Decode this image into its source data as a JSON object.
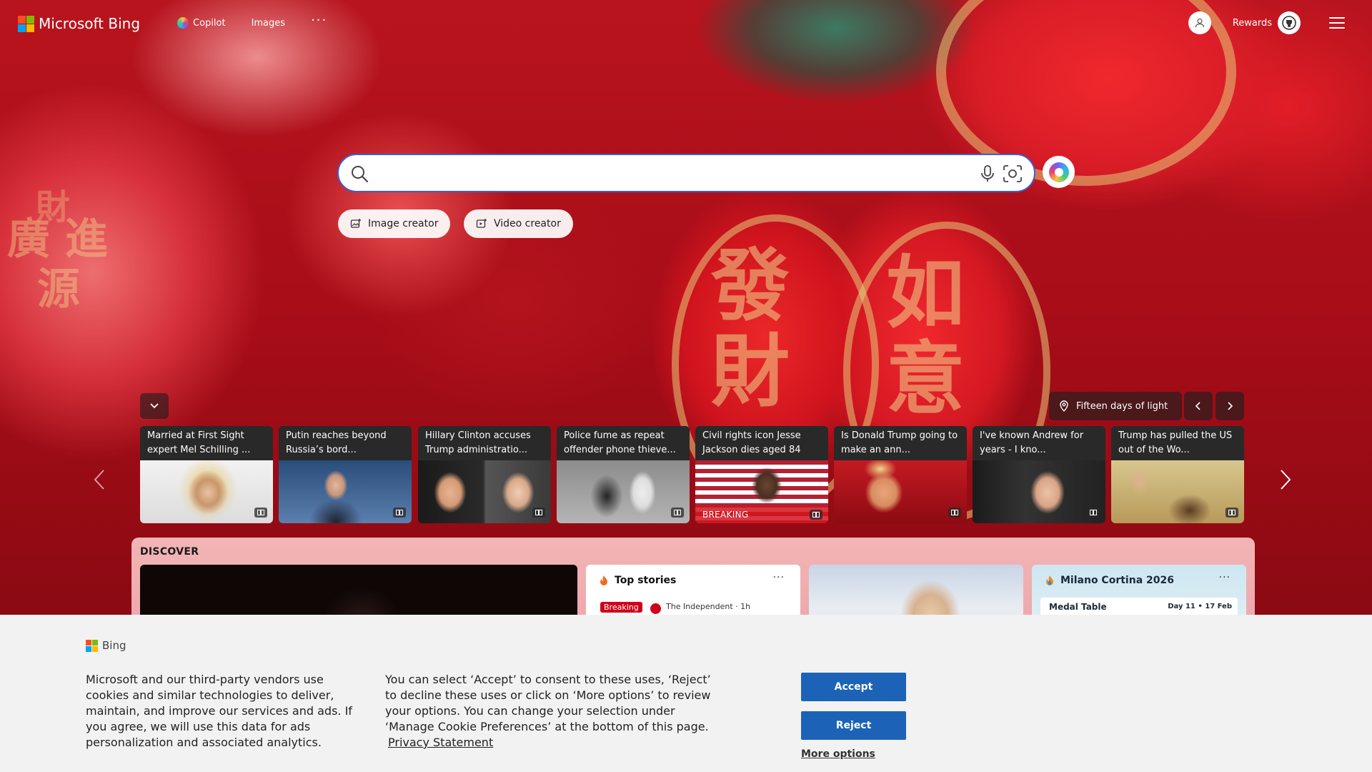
{
  "header": {
    "logo_text": "Microsoft Bing",
    "nav": [
      {
        "label": "Copilot"
      },
      {
        "label": "Images"
      }
    ],
    "more_label": "···",
    "rewards_label": "Rewards"
  },
  "search": {
    "placeholder": "",
    "value": ""
  },
  "creators": {
    "image_creator": "Image creator",
    "video_creator": "Video creator"
  },
  "location": {
    "label": "Fifteen days of light"
  },
  "news_cards": [
    {
      "title": "Married at First Sight expert Mel Schilling ...",
      "badge": ""
    },
    {
      "title": "Putin reaches beyond Russia’s bord...",
      "badge": ""
    },
    {
      "title": "Hillary Clinton accuses Trump administratio...",
      "badge": ""
    },
    {
      "title": "Police fume as repeat offender phone thieve...",
      "badge": ""
    },
    {
      "title": "Civil rights icon Jesse Jackson dies aged 84",
      "badge": "BREAKING"
    },
    {
      "title": "Is Donald Trump going to make an ann...",
      "badge": ""
    },
    {
      "title": "I've known Andrew for years - I kno...",
      "badge": ""
    },
    {
      "title": "Trump has pulled the US out of the Wo...",
      "badge": ""
    }
  ],
  "discover": {
    "title": "DISCOVER",
    "top_stories": {
      "title": "Top stories",
      "more": "···",
      "badge": "Breaking",
      "source": "The Independent · 1h"
    },
    "milano": {
      "title": "Milano Cortina 2026",
      "more": "···",
      "medal_table": "Medal Table",
      "day": "Day 11 • 17 Feb"
    }
  },
  "cookie": {
    "brand": "Bing",
    "text1": "Microsoft and our third-party vendors use cookies and similar technologies to deliver, maintain, and improve our services and ads. If you agree, we will use this data for ads personalization and associated analytics.",
    "text2": "You can select ‘Accept’ to consent to these uses, ‘Reject’ to decline these uses or click on ‘More options’ to review your options. You can change your selection under ‘Manage Cookie Preferences’ at the bottom of this page.",
    "privacy_link": "Privacy Statement",
    "accept": "Accept",
    "reject": "Reject",
    "more_options": "More options"
  },
  "colors": {
    "ms_red": "#f25022",
    "ms_green": "#7fba00",
    "ms_blue": "#00a4ef",
    "ms_yellow": "#ffb900",
    "search_border": "#3d5cd8",
    "cookie_button": "#1c63b8",
    "breaking_red": "#d0021b"
  }
}
